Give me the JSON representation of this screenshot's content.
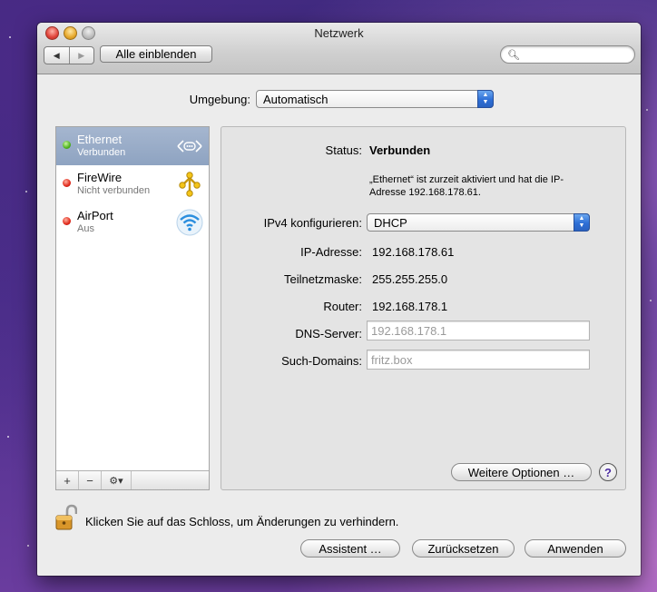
{
  "window": {
    "title": "Netzwerk"
  },
  "toolbar": {
    "back_glyph": "◀",
    "forward_glyph": "▶",
    "show_all_label": "Alle einblenden",
    "search_placeholder": "",
    "search_icon": "magnifier-icon"
  },
  "location": {
    "label": "Umgebung:",
    "value": "Automatisch"
  },
  "services": [
    {
      "name": "Ethernet",
      "status": "Verbunden",
      "state_color": "#4eb21e",
      "icon": "ethernet-icon",
      "selected": true
    },
    {
      "name": "FireWire",
      "status": "Nicht verbunden",
      "state_color": "#e0281a",
      "icon": "firewire-icon",
      "selected": false
    },
    {
      "name": "AirPort",
      "status": "Aus",
      "state_color": "#e0281a",
      "icon": "airport-icon",
      "selected": false
    }
  ],
  "sidebar_buttons": {
    "add": "+",
    "remove": "−",
    "gear": "⚙▾"
  },
  "detail": {
    "status_label": "Status:",
    "status_value": "Verbunden",
    "status_desc_line1": "„Ethernet“ ist zurzeit aktiviert und hat die IP-",
    "status_desc_line2": "Adresse 192.168.178.61.",
    "ipv4_label": "IPv4 konfigurieren:",
    "ipv4_value": "DHCP",
    "ip_label": "IP-Adresse:",
    "ip_value": "192.168.178.61",
    "mask_label": "Teilnetzmaske:",
    "mask_value": "255.255.255.0",
    "router_label": "Router:",
    "router_value": "192.168.178.1",
    "dns_label": "DNS-Server:",
    "dns_placeholder": "192.168.178.1",
    "search_domains_label": "Such-Domains:",
    "search_domains_placeholder": "fritz.box",
    "advanced_button": "Weitere Optionen …",
    "help_glyph": "?"
  },
  "footer": {
    "lock_text": "Klicken Sie auf das Schloss, um Änderungen zu verhindern.",
    "assistant_button": "Assistent …",
    "revert_button": "Zurücksetzen",
    "apply_button": "Anwenden"
  },
  "colors": {
    "selection": "#8ea3c1",
    "accent_blue": "#2e6fd6"
  }
}
